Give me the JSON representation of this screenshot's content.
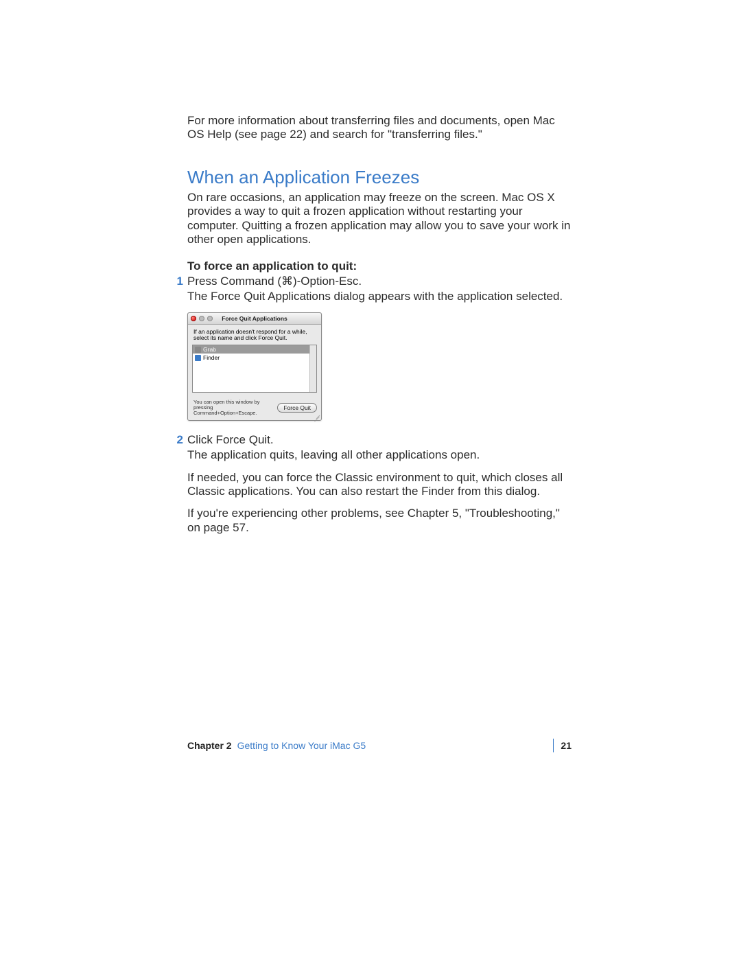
{
  "intro": "For more information about transferring files and documents, open Mac OS Help (see page 22) and search for \"transferring files.\"",
  "heading": "When an Application Freezes",
  "heading_body": "On rare occasions, an application may freeze on the screen. Mac OS X provides a way to quit a frozen application without restarting your computer. Quitting a frozen application may allow you to save your work in other open applications.",
  "subhead": "To force an application to quit:",
  "steps": [
    {
      "num": "1",
      "text": "Press Command (⌘)-Option-Esc.",
      "after": "The Force Quit Applications dialog appears with the application selected."
    },
    {
      "num": "2",
      "text": "Click Force Quit.",
      "after": "The application quits, leaving all other applications open."
    }
  ],
  "note1": "If needed, you can force the Classic environment to quit, which closes all Classic applications. You can also restart the Finder from this dialog.",
  "note2": "If you're experiencing other problems, see Chapter 5, \"Troubleshooting,\" on page 57.",
  "dialog": {
    "title": "Force Quit Applications",
    "message": "If an application doesn't respond for a while, select its name and click Force Quit.",
    "items": [
      {
        "name": "Grab",
        "selected": true
      },
      {
        "name": "Finder",
        "selected": false
      }
    ],
    "hint": "You can open this window by pressing Command+Option+Escape.",
    "button": "Force Quit"
  },
  "footer": {
    "chapter": "Chapter 2",
    "title": "Getting to Know Your iMac G5",
    "page": "21"
  }
}
